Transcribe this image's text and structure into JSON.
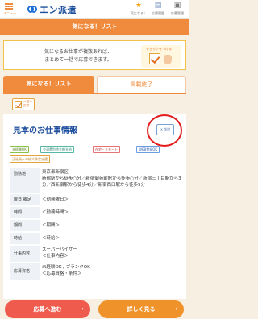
{
  "header": {
    "menu_label": "メニュー",
    "logo_text": "エン派遣",
    "icons": [
      {
        "name": "favorites",
        "glyph": "★",
        "label": "気になる！"
      },
      {
        "name": "history",
        "glyph": "▤",
        "label": "応募履歴"
      },
      {
        "name": "apply",
        "glyph": "▣",
        "label": "応募管理"
      }
    ]
  },
  "page_title": "気になる！リスト",
  "banner": {
    "line1": "気になるお仕事が複数あれば、",
    "line2": "まとめて一括で応募できます。",
    "hint_tag": "チェックをつける"
  },
  "tabs": [
    {
      "label": "気になる！リスト",
      "active": true
    },
    {
      "label": "掲載終了",
      "active": false
    }
  ],
  "select_all": {
    "label": "一括で応募"
  },
  "job": {
    "title": "見本のお仕事情報",
    "delete_label": "✕ 削除",
    "tags": [
      "未経験OK",
      "交通費別途全額支給",
      "在宅・リモート",
      "WEB登録OK",
      "正社員への紹介予定派遣"
    ],
    "rows": [
      {
        "label": "勤務地",
        "value": "東京都新宿区\n新宿駅から徒歩○分／新宿御苑前駅から徒歩○分／新宿三丁目駅から3分／西新宿駅から徒歩4分／新宿西口駅から徒歩5分"
      },
      {
        "label": "曜日 補足",
        "value": "＜勤務曜日＞"
      },
      {
        "label": "時間",
        "value": "＜勤務時間＞"
      },
      {
        "label": "期間",
        "value": "＜期間＞"
      },
      {
        "label": "時給",
        "value": "＜時給＞"
      },
      {
        "label": "仕事内容",
        "value": "スーパーバイザー\n＜仕事内容＞"
      },
      {
        "label": "応募資格",
        "value": "未経験OK / ブランクOK\n＜応募資格・条件＞"
      }
    ]
  },
  "buttons": {
    "apply": "応募へ進む",
    "detail": "詳しく見る"
  },
  "colors": {
    "accent": "#f08a3c",
    "link": "#1d4e9e",
    "apply": "#ef5b4c"
  }
}
